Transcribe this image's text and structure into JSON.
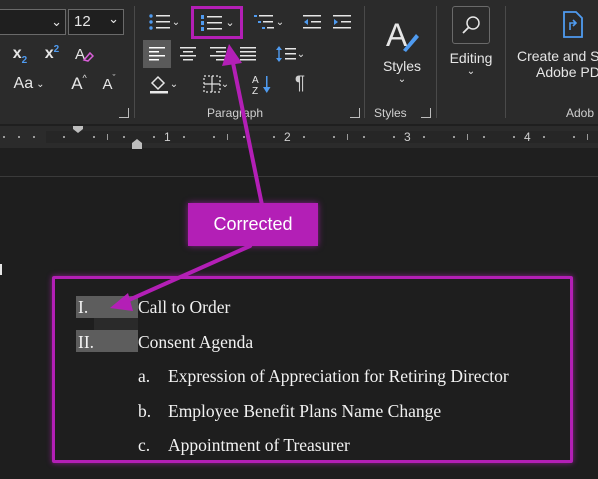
{
  "toolbar": {
    "font_size": "12",
    "font_size_caret": "⌄",
    "subscript": "x",
    "subscript_sub": "2",
    "superscript": "x",
    "superscript_sup": "2",
    "change_case": "Aa",
    "grow_font": "A",
    "shrink_font": "A",
    "show_marks": "¶",
    "sort": "A↓Z",
    "paragraph_group_label": "Paragraph",
    "styles_group_label": "Styles",
    "styles_button_label": "Styles",
    "editing_label": "Editing",
    "adobe_label_line1": "Create and S",
    "adobe_label_line2": "Adobe PD",
    "adobe_group_label": "Adob"
  },
  "ruler": {
    "numbers": [
      "1",
      "2",
      "3",
      "4"
    ]
  },
  "annotation": {
    "callout_text": "Corrected"
  },
  "document": {
    "items": [
      {
        "num": "I.",
        "text": "Call to Order"
      },
      {
        "num": "II.",
        "text": "Consent Agenda"
      },
      {
        "num": "a.",
        "text": "Expression of Appreciation for Retiring Director"
      },
      {
        "num": "b.",
        "text": "Employee Benefit Plans Name Change"
      },
      {
        "num": "c.",
        "text": "Appointment of Treasurer"
      }
    ]
  },
  "colors": {
    "annotation": "#b31fb6",
    "ribbon": "#2b2b2b",
    "document": "#1e1e1e",
    "accent_blue": "#4f9bf0"
  }
}
